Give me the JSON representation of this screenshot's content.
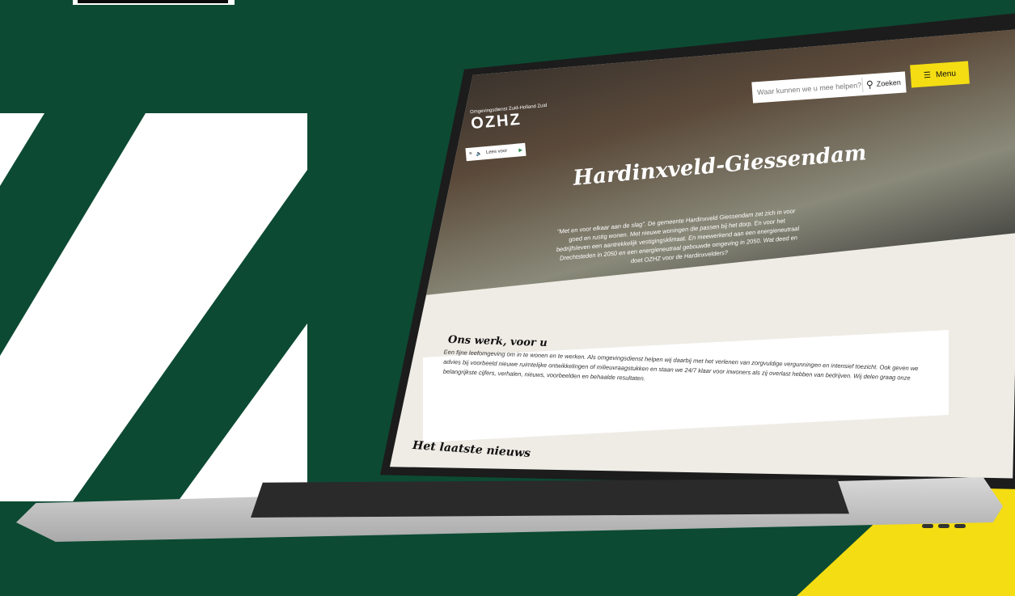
{
  "colors": {
    "background": "#0c4a33",
    "accent_yellow": "#f4dd12",
    "surface": "#efece6",
    "white": "#ffffff"
  },
  "website": {
    "header": {
      "search_placeholder": "Waar kunnen we u mee helpen?",
      "search_button": "Zoeken",
      "menu_button": "Menu",
      "search_icon": "search-icon",
      "menu_icon": "hamburger-icon"
    },
    "brand": {
      "org_name": "Omgevingsdienst Zuid-Holland Zuid",
      "logo": "OZHZ"
    },
    "readaloud": {
      "label": "Lees voor",
      "icons": [
        "hamburger-icon",
        "speaker-icon",
        "play-icon"
      ]
    },
    "hero": {
      "title": "Hardinxveld-Giessendam",
      "intro": "\"Met en voor elkaar aan de slag\". De gemeente Hardinxveld Giessendam zet zich in voor goed en rustig wonen. Met nieuwe woningen die passen bij het dorp. En voor het bedrijfsleven een aantrekkelijk vestigingsklimaat. En meewerkend aan een energieneutraal Drechtsteden in 2050 en een energieneutraal gebouwde omgeving in 2050. Wat deed en doet OZHZ voor de Hardinxvelders?"
    },
    "work": {
      "title": "Ons werk, voor u",
      "body": "Een fijne leefomgeving om in te wonen en te werken. Als omgevingsdienst helpen wij daarbij met het verlenen van zorgvuldige vergunningen en intensief toezicht. Ook geven we advies bij voorbeeld nieuwe ruimtelijke ontwikkelingen of milieuvraagstukken en staan we 24/7 klaar voor inwoners als zij overlast hebben van bedrijven. Wij delen graag onze belangrijkste cijfers, verhalen, nieuws, voorbeelden en behaalde resultaten."
    },
    "news": {
      "title": "Het laatste nieuws"
    }
  }
}
